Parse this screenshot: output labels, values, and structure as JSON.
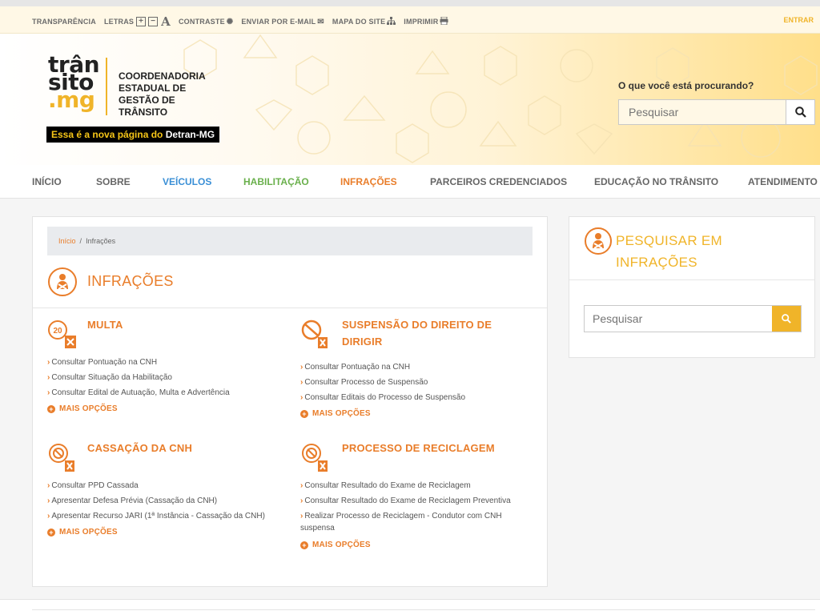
{
  "util_bar": {
    "items": [
      "TRANSPARÊNCIA",
      "LETRAS",
      "CONTRASTE",
      "ENVIAR POR E-MAIL",
      "MAPA DO SITE",
      "IMPRIMIR"
    ],
    "letras_plus": "+",
    "letras_minus": "−",
    "letras_a": "A",
    "login": "ENTRAR"
  },
  "header": {
    "logo_line1": "trân",
    "logo_line2": "sito",
    "logo_line3": ".mg",
    "org_line1": "COORDENADORIA",
    "org_line2": "ESTADUAL DE",
    "org_line3": "GESTÃO DE TRÂNSITO",
    "tagline_prefix": "Essa é a nova página do ",
    "tagline_strong": "Detran-MG",
    "search_label": "O que você está procurando?",
    "search_placeholder": "Pesquisar"
  },
  "nav": {
    "items": [
      {
        "label": "INÍCIO",
        "color": "#666666"
      },
      {
        "label": "SOBRE",
        "color": "#666666"
      },
      {
        "label": "VEÍCULOS",
        "color": "#3a8fd6"
      },
      {
        "label": "HABILITAÇÃO",
        "color": "#6ab04c"
      },
      {
        "label": "INFRAÇÕES",
        "color": "#e97d2a"
      },
      {
        "label": "PARCEIROS CREDENCIADOS",
        "color": "#666666"
      },
      {
        "label": "EDUCAÇÃO NO TRÂNSITO",
        "color": "#666666"
      },
      {
        "label": "ATENDIMENTO",
        "color": "#666666"
      }
    ]
  },
  "breadcrumb": {
    "home": "Início",
    "separator": "/",
    "current": "Infrações"
  },
  "page_title": "INFRAÇÕES",
  "sections": [
    {
      "title": "MULTA",
      "icon": "speed-limit-icon",
      "links": [
        "Consultar Pontuação na CNH",
        "Consultar Situação da Habilitação",
        "Consultar Edital de Autuação, Multa e Advertência"
      ],
      "more": "MAIS OPÇÕES"
    },
    {
      "title_line1": "SUSPENSÃO DO DIREITO DE",
      "title_line2": "DIRIGIR",
      "icon": "no-entry-icon",
      "links": [
        "Consultar Pontuação na CNH",
        "Consultar Processo de Suspensão",
        "Consultar Editais do Processo de Suspensão"
      ],
      "more": "MAIS OPÇÕES"
    },
    {
      "title": "CASSAÇÃO DA CNH",
      "icon": "license-cancel-icon",
      "links": [
        "Consultar PPD Cassada",
        "Apresentar Defesa Prévia (Cassação da CNH)",
        "Apresentar Recurso JARI (1ª Instância - Cassação da CNH)"
      ],
      "more": "MAIS OPÇÕES"
    },
    {
      "title": "PROCESSO DE RECICLAGEM",
      "icon": "recycle-course-icon",
      "links": [
        "Consultar Resultado do Exame de Reciclagem",
        "Consultar Resultado do Exame de Reciclagem Preventiva",
        "Realizar Processo de Reciclagem - Condutor com CNH suspensa"
      ],
      "more": "MAIS OPÇÕES"
    }
  ],
  "side": {
    "title_line1": "PESQUISAR EM",
    "title_line2": "INFRAÇÕES",
    "search_placeholder": "Pesquisar"
  },
  "colors": {
    "accent_orange": "#e97d2a",
    "accent_yellow": "#f0b429",
    "vehicles_blue": "#3a8fd6",
    "license_green": "#6ab04c"
  }
}
